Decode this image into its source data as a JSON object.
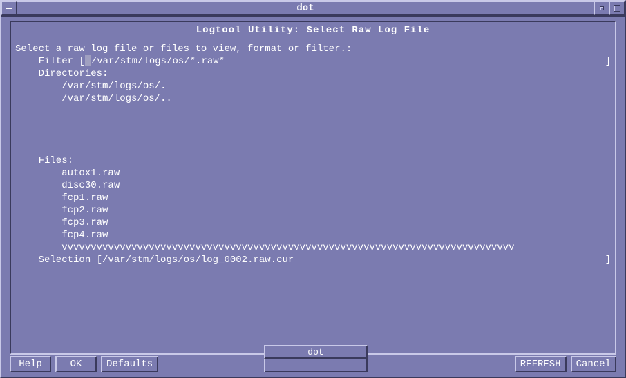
{
  "window": {
    "title": "dot"
  },
  "header": "Logtool Utility:   Select Raw Log File",
  "instruction": "Select a raw log file or files to view, format or filter.:",
  "filter": {
    "label": "    Filter [",
    "value": "/var/stm/logs/os/*.raw*",
    "close": "]"
  },
  "directories": {
    "label": "    Directories:",
    "items": [
      "        /var/stm/logs/os/.",
      "        /var/stm/logs/os/.."
    ]
  },
  "files": {
    "label": "    Files:",
    "items": [
      "        autox1.raw",
      "        disc30.raw",
      "        fcp1.raw",
      "        fcp2.raw",
      "        fcp3.raw",
      "        fcp4.raw"
    ],
    "scroll_indicator": "        vvvvvvvvvvvvvvvvvvvvvvvvvvvvvvvvvvvvvvvvvvvvvvvvvvvvvvvvvvvvvvvvvvvvvvvvvvvvvv"
  },
  "selection": {
    "label": "    Selection [",
    "value": "/var/stm/logs/os/log_0002.raw.cur",
    "close": "]"
  },
  "buttons": {
    "help": "Help",
    "ok": "OK",
    "defaults": "Defaults",
    "refresh": "REFRESH",
    "cancel": "Cancel"
  },
  "mini_window": {
    "title": "dot"
  }
}
